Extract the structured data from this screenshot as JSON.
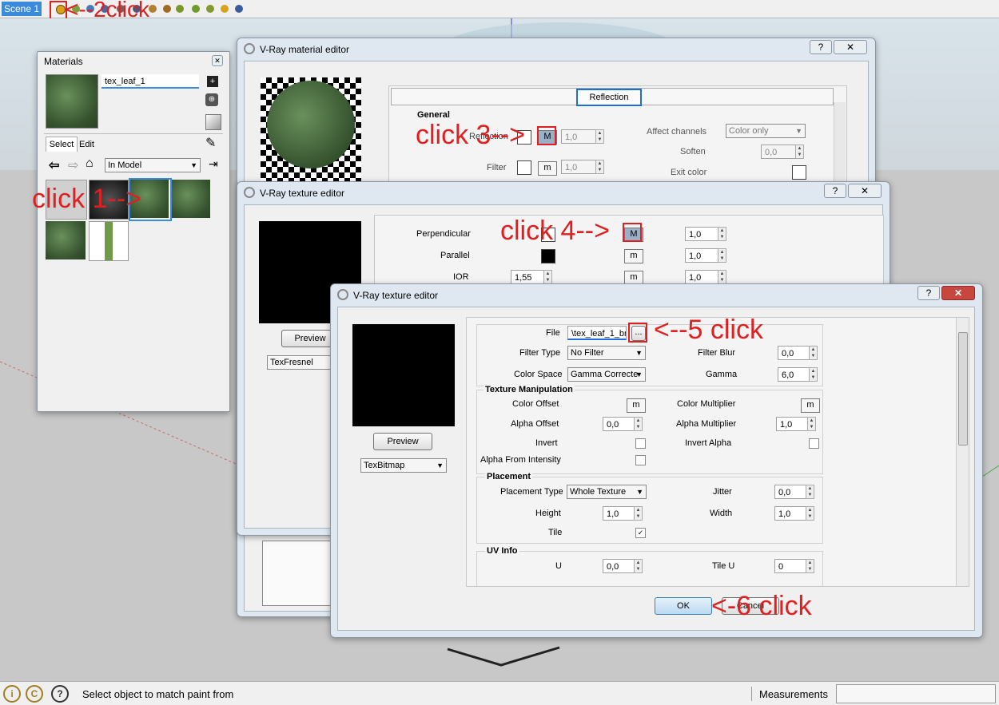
{
  "toolbar": {
    "scene_tab": "Scene 1"
  },
  "annotations": {
    "click1": "click 1-->",
    "click2": "<--2click",
    "click3": "click 3-->",
    "click4": "click 4-->",
    "click5": "<--5 click",
    "click6": "<-6 click"
  },
  "materials": {
    "title": "Materials",
    "name": "tex_leaf_1",
    "tab_select": "Select",
    "tab_edit": "Edit",
    "collection": "In Model"
  },
  "vray_material_editor": {
    "title": "V-Ray material editor",
    "section_button": "Reflection",
    "group_general": "General",
    "reflection_label": "Reflection",
    "reflection_m": "M",
    "reflection_value": "1,0",
    "filter_label": "Filter",
    "filter_m": "m",
    "filter_value": "1,0",
    "affect_channels_label": "Affect channels",
    "affect_channels_value": "Color only",
    "soften_label": "Soften",
    "soften_value": "0,0",
    "exit_color_label": "Exit color"
  },
  "texture_editor_1": {
    "title": "V-Ray texture editor",
    "perpendicular_label": "Perpendicular",
    "perpendicular_m": "M",
    "perpendicular_value": "1,0",
    "parallel_label": "Parallel",
    "parallel_m": "m",
    "parallel_value": "1,0",
    "ior_label": "IOR",
    "ior_value": "1,55",
    "ior_m": "m",
    "ior_value2": "1,0",
    "preview_button": "Preview",
    "texture_type": "TexFresnel"
  },
  "texture_editor_2": {
    "title": "V-Ray texture editor",
    "file_label": "File",
    "file_value": "\\tex_leaf_1_br",
    "browse_button": "...",
    "filter_type_label": "Filter Type",
    "filter_type_value": "No Filter",
    "filter_blur_label": "Filter Blur",
    "filter_blur_value": "0,0",
    "color_space_label": "Color Space",
    "color_space_value": "Gamma Correcte",
    "gamma_label": "Gamma",
    "gamma_value": "6,0",
    "group_texture_manipulation": "Texture Manipulation",
    "color_offset_label": "Color Offset",
    "color_offset_m": "m",
    "color_multiplier_label": "Color Multiplier",
    "color_multiplier_m": "m",
    "alpha_offset_label": "Alpha Offset",
    "alpha_offset_value": "0,0",
    "alpha_multiplier_label": "Alpha Multiplier",
    "alpha_multiplier_value": "1,0",
    "invert_label": "Invert",
    "invert_alpha_label": "Invert Alpha",
    "alpha_from_intensity_label": "Alpha From Intensity",
    "group_placement": "Placement",
    "placement_type_label": "Placement Type",
    "placement_type_value": "Whole Texture",
    "jitter_label": "Jitter",
    "jitter_value": "0,0",
    "height_label": "Height",
    "height_value": "1,0",
    "width_label": "Width",
    "width_value": "1,0",
    "tile_label": "Tile",
    "group_uv_info": "UV Info",
    "u_label": "U",
    "u_value": "0,0",
    "tile_u_label": "Tile U",
    "tile_u_value": "0",
    "preview_button": "Preview",
    "texture_type": "TexBitmap",
    "ok_button": "OK",
    "cancel_button": "Cancel"
  },
  "status": {
    "message": "Select object to match paint from",
    "measurements_label": "Measurements"
  }
}
